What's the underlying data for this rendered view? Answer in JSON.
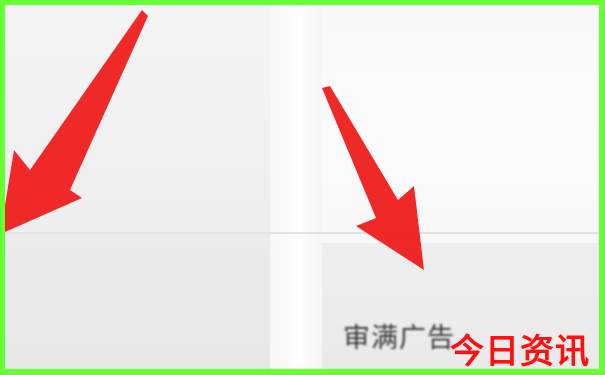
{
  "menu": {
    "visible_label": "审满广告"
  },
  "watermark": {
    "text": "今日资讯",
    "color": "#ff1010"
  },
  "colors": {
    "frame": "#66ff33",
    "arrow": "#ee1c1c"
  }
}
